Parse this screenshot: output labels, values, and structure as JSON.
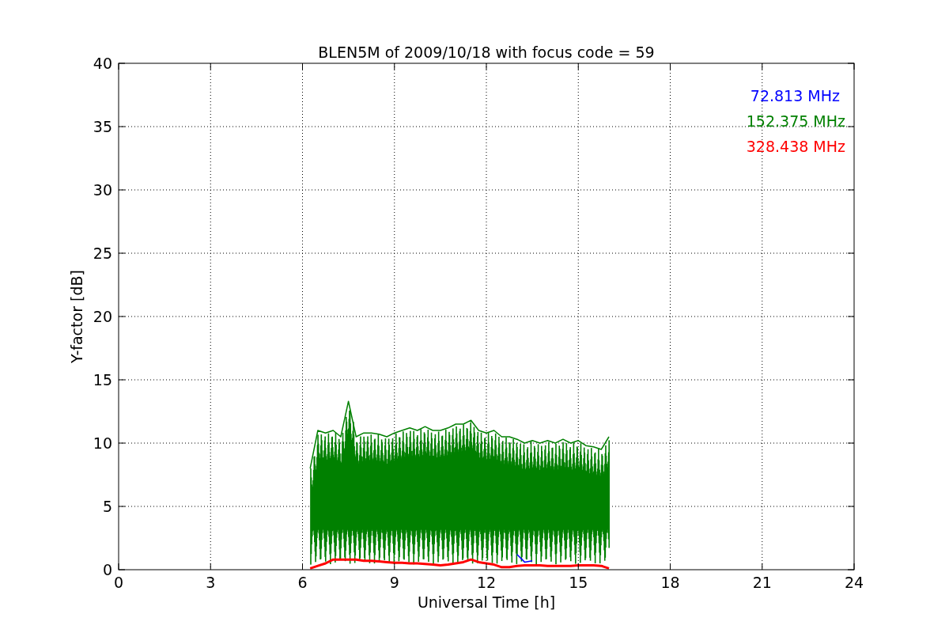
{
  "chart_data": {
    "type": "line",
    "title": "BLEN5M of 2009/10/18 with focus code = 59",
    "xlabel": "Universal Time [h]",
    "ylabel": "Y-factor [dB]",
    "xlim": [
      0,
      24
    ],
    "ylim": [
      0,
      40
    ],
    "xticks": [
      0,
      3,
      6,
      9,
      12,
      15,
      18,
      21,
      24
    ],
    "yticks": [
      0,
      5,
      10,
      15,
      20,
      25,
      30,
      35,
      40
    ],
    "grid": true,
    "x": [
      6.25,
      6.5,
      6.75,
      7,
      7.25,
      7.5,
      7.75,
      8,
      8.25,
      8.5,
      8.75,
      9,
      9.25,
      9.5,
      9.75,
      10,
      10.25,
      10.5,
      10.75,
      11,
      11.25,
      11.5,
      11.75,
      12,
      12.25,
      12.5,
      12.75,
      13,
      13.25,
      13.5,
      13.75,
      14,
      14.25,
      14.5,
      14.75,
      15,
      15.25,
      15.5,
      15.75,
      16
    ],
    "series": [
      {
        "name": "72.813 MHz",
        "color": "#0000ff",
        "values": [
          null,
          null,
          null,
          null,
          null,
          null,
          null,
          null,
          null,
          null,
          null,
          null,
          null,
          null,
          null,
          null,
          null,
          null,
          null,
          null,
          null,
          null,
          null,
          null,
          null,
          null,
          null,
          1.2,
          0.6,
          0.7,
          null,
          null,
          null,
          null,
          null,
          null,
          null,
          null,
          null,
          null
        ]
      },
      {
        "name": "152.375 MHz",
        "color": "#008000",
        "values": [
          8,
          11,
          10.8,
          11,
          10.5,
          13.3,
          10.5,
          10.8,
          10.8,
          10.7,
          10.5,
          10.8,
          11,
          11.2,
          11,
          11.3,
          11,
          11,
          11.2,
          11.5,
          11.5,
          11.8,
          11,
          10.8,
          11,
          10.5,
          10.5,
          10.3,
          10,
          10.2,
          10,
          10.2,
          10,
          10.3,
          10,
          10.2,
          9.8,
          9.7,
          9.5,
          10.5
        ]
      },
      {
        "name": "328.438 MHz",
        "color": "#ff0000",
        "values": [
          0.1,
          0.3,
          0.5,
          0.8,
          0.8,
          0.8,
          0.8,
          0.7,
          0.7,
          0.65,
          0.6,
          0.55,
          0.55,
          0.5,
          0.5,
          0.45,
          0.4,
          0.35,
          0.4,
          0.5,
          0.6,
          0.8,
          0.6,
          0.5,
          0.4,
          0.2,
          0.2,
          0.3,
          0.35,
          0.35,
          0.35,
          0.3,
          0.3,
          0.3,
          0.3,
          0.35,
          0.35,
          0.35,
          0.3,
          0.1
        ]
      }
    ]
  }
}
